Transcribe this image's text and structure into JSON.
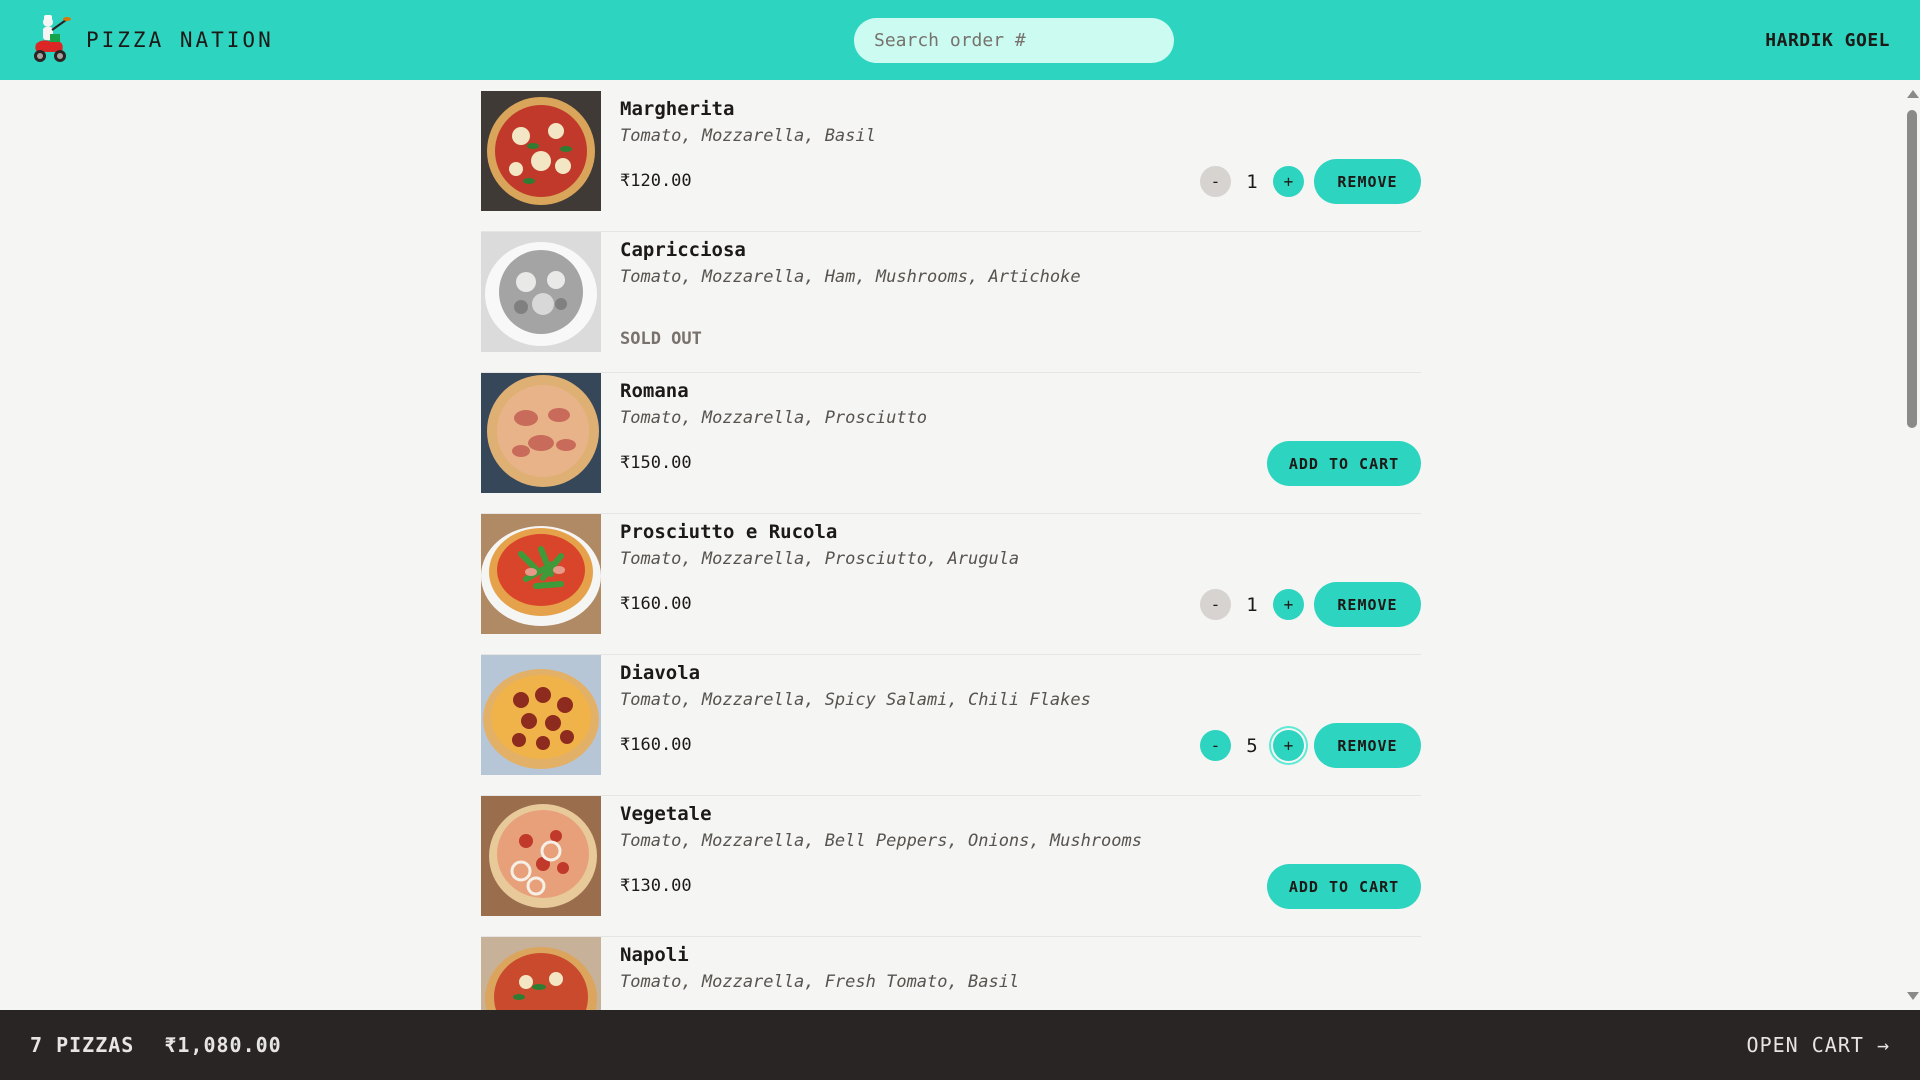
{
  "header": {
    "brand_name": "PIZZA NATION",
    "search_placeholder": "Search order #",
    "user_name": "HARDIK GOEL"
  },
  "menu": [
    {
      "name": "Margherita",
      "ingredients": "Tomato, Mozzarella, Basil",
      "price": "₹120.00",
      "quantity": "1",
      "minus_label": "-",
      "plus_label": "+",
      "action_label": "REMOVE"
    },
    {
      "name": "Capricciosa",
      "ingredients": "Tomato, Mozzarella, Ham, Mushrooms, Artichoke",
      "status": "SOLD OUT"
    },
    {
      "name": "Romana",
      "ingredients": "Tomato, Mozzarella, Prosciutto",
      "price": "₹150.00",
      "action_label": "ADD TO CART"
    },
    {
      "name": "Prosciutto e Rucola",
      "ingredients": "Tomato, Mozzarella, Prosciutto, Arugula",
      "price": "₹160.00",
      "quantity": "1",
      "minus_label": "-",
      "plus_label": "+",
      "action_label": "REMOVE"
    },
    {
      "name": "Diavola",
      "ingredients": "Tomato, Mozzarella, Spicy Salami, Chili Flakes",
      "price": "₹160.00",
      "quantity": "5",
      "minus_label": "-",
      "plus_label": "+",
      "action_label": "REMOVE"
    },
    {
      "name": "Vegetale",
      "ingredients": "Tomato, Mozzarella, Bell Peppers, Onions, Mushrooms",
      "price": "₹130.00",
      "action_label": "ADD TO CART"
    },
    {
      "name": "Napoli",
      "ingredients": "Tomato, Mozzarella, Fresh Tomato, Basil"
    }
  ],
  "footer": {
    "pizza_count": "7 PIZZAS",
    "total": "₹1,080.00",
    "open_cart_label": "OPEN CART →"
  },
  "colors": {
    "accent": "#2dd4bf",
    "background": "#f5f5f4",
    "footer_bg": "#292524"
  }
}
